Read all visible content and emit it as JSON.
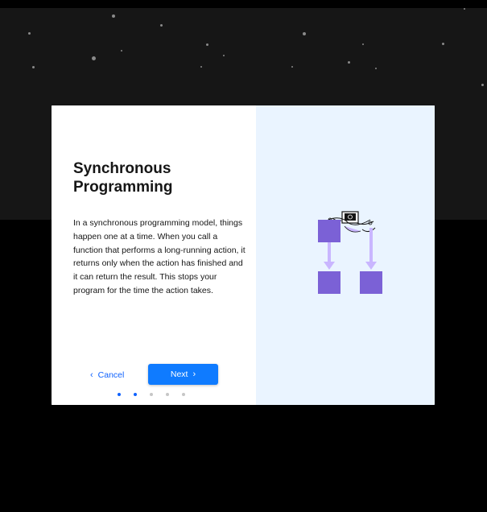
{
  "modal": {
    "title": "Synchronous Programming",
    "body": "In a synchronous programming model, things happen one at a time. When you call a function that performs a long-running action, it returns only when the action has finished and it can return the result. This stops your program for the time the action takes.",
    "cancel_label": "Cancel",
    "next_label": "Next",
    "progress": {
      "current_step": 2,
      "total_steps": 5
    }
  },
  "colors": {
    "primary": "#0f7bff",
    "link": "#0f62fe",
    "illustration_block": "#7b61d6",
    "illustration_arrow": "#c9b6ff",
    "panel_background": "#eaf4ff"
  },
  "icons": {
    "cancel": "chevron-left-icon",
    "next": "chevron-right-icon",
    "illustration": "synchronous-flow-illustration"
  }
}
